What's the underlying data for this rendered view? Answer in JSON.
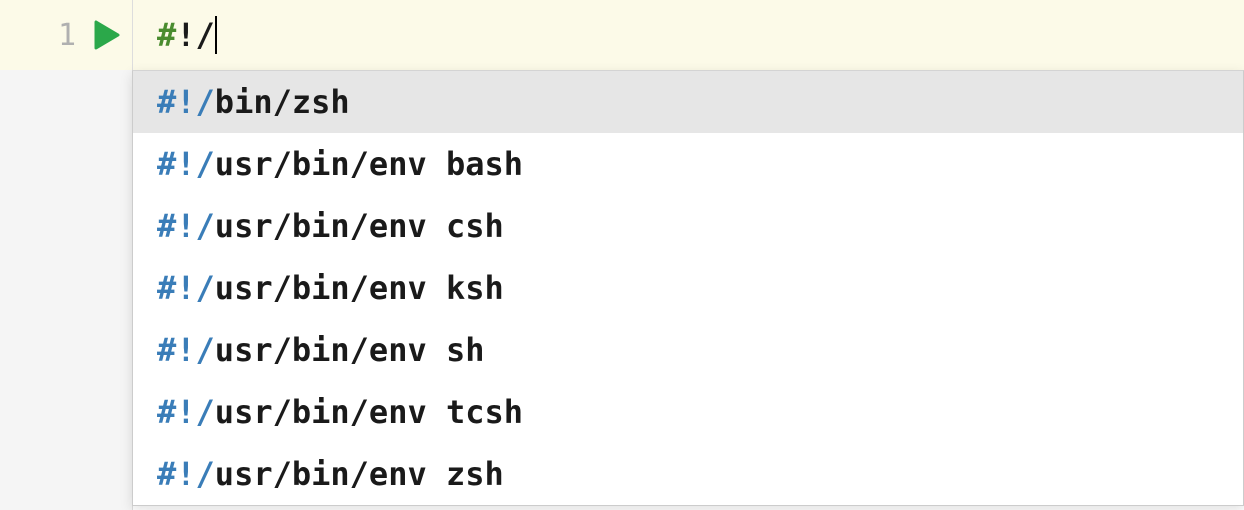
{
  "editor": {
    "line_number": "1",
    "content_hash": "#",
    "content_rest": "!/"
  },
  "autocomplete": {
    "items": [
      {
        "prefix": "#!/",
        "path": "bin/zsh",
        "selected": true
      },
      {
        "prefix": "#!/",
        "path": "usr/bin/env bash",
        "selected": false
      },
      {
        "prefix": "#!/",
        "path": "usr/bin/env csh",
        "selected": false
      },
      {
        "prefix": "#!/",
        "path": "usr/bin/env ksh",
        "selected": false
      },
      {
        "prefix": "#!/",
        "path": "usr/bin/env sh",
        "selected": false
      },
      {
        "prefix": "#!/",
        "path": "usr/bin/env tcsh",
        "selected": false
      },
      {
        "prefix": "#!/",
        "path": "usr/bin/env zsh",
        "selected": false
      }
    ]
  }
}
